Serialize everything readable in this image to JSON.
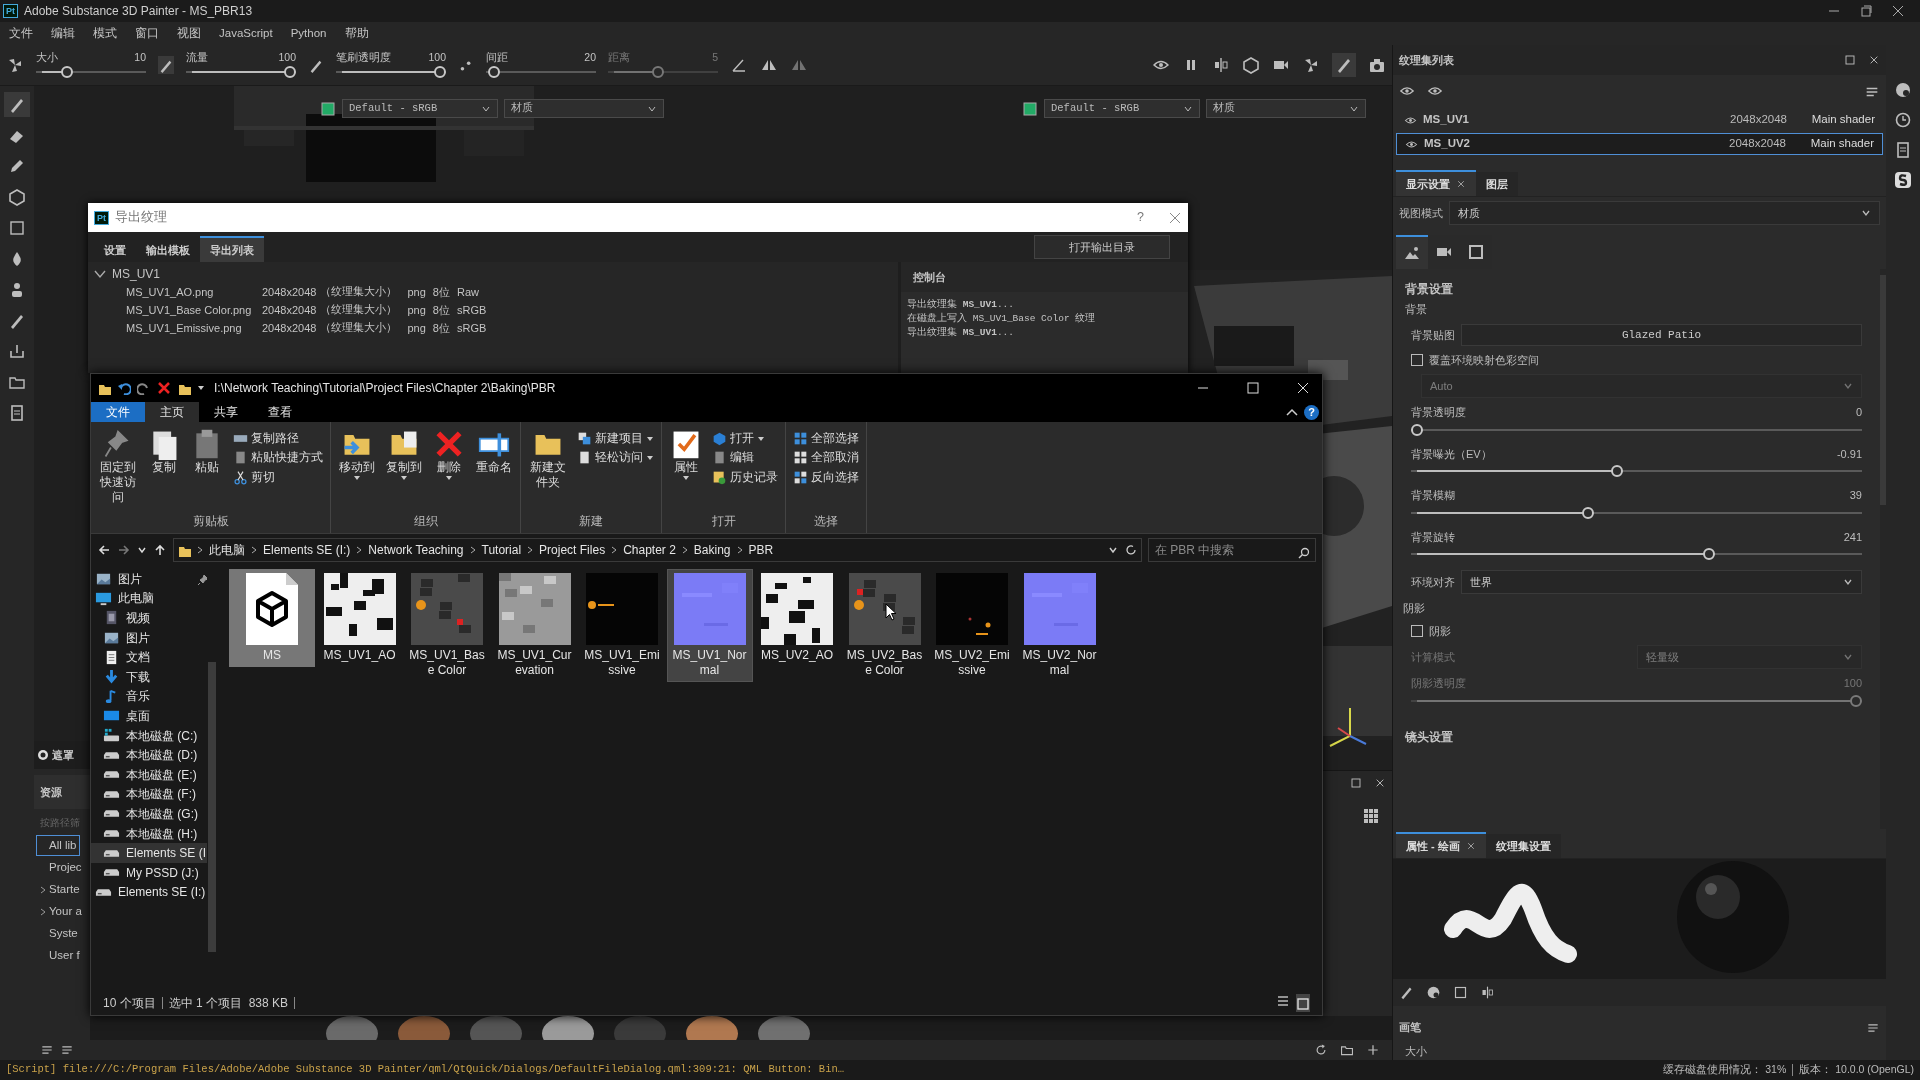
{
  "app": {
    "logo": "Pt",
    "title": "Adobe Substance 3D Painter - MS_PBR13",
    "menu": [
      "文件",
      "编辑",
      "模式",
      "窗口",
      "视图",
      "JavaScript",
      "Python",
      "帮助"
    ]
  },
  "tool_options": {
    "sliders": [
      {
        "label": "大小",
        "value": "10",
        "level": 0.25,
        "disabled": false
      },
      {
        "label": "流量",
        "value": "100",
        "level": 1,
        "disabled": false
      },
      {
        "label": "笔刷透明度",
        "value": "100",
        "level": 1,
        "disabled": false
      },
      {
        "label": "间距",
        "value": "20",
        "level": 0.02,
        "disabled": false
      },
      {
        "label": "距离",
        "value": "5",
        "level": 0.45,
        "disabled": true
      }
    ]
  },
  "viewport_views": [
    {
      "colorspace": "Default - sRGB",
      "mode": "材质"
    },
    {
      "colorspace": "Default - sRGB",
      "mode": "材质"
    }
  ],
  "export_dialog": {
    "logo": "Pt",
    "title": "导出纹理",
    "help": "?",
    "tabs": [
      {
        "label": "设置",
        "selected": false
      },
      {
        "label": "输出模板",
        "selected": false
      },
      {
        "label": "导出列表",
        "selected": true
      }
    ],
    "open_button": "打开输出目录",
    "texture_set": {
      "name": "MS_UV1",
      "expanded": true,
      "files": [
        {
          "name": "MS_UV1_AO.png",
          "size": "2048x2048",
          "note": "（纹理集大小）",
          "format": "png",
          "depth": "8位",
          "colorspace": "Raw"
        },
        {
          "name": "MS_UV1_Base Color.png",
          "size": "2048x2048",
          "note": "（纹理集大小）",
          "format": "png",
          "depth": "8位",
          "colorspace": "sRGB"
        },
        {
          "name": "MS_UV1_Emissive.png",
          "size": "2048x2048",
          "note": "（纹理集大小）",
          "format": "png",
          "depth": "8位",
          "colorspace": "sRGB"
        }
      ]
    },
    "console": {
      "title": "控制台",
      "lines": [
        "导出纹理集 **MS_UV1**...",
        "在磁盘上写入 MS_UV1_Base Color 纹理",
        "导出纹理集 **MS_UV1**..."
      ]
    }
  },
  "explorer": {
    "path": "I:\\Network Teaching\\Tutorial\\Project Files\\Chapter 2\\Baking\\PBR",
    "file_tab": "文件",
    "help": "?",
    "tabs": [
      {
        "label": "主页",
        "selected": true
      },
      {
        "label": "共享",
        "selected": false
      },
      {
        "label": "查看",
        "selected": false
      }
    ],
    "ribbon": [
      {
        "label": "剪贴板",
        "buttons": [
          {
            "label": "固定到快速访问",
            "kind": "pin",
            "dropdown": false
          },
          {
            "label": "复制",
            "kind": "copy",
            "dropdown": false
          },
          {
            "label": "粘贴",
            "kind": "paste",
            "dropdown": false
          }
        ],
        "menu_items": [
          {
            "label": "复制路径",
            "kind": "path",
            "dropdown": false
          },
          {
            "label": "粘贴快捷方式",
            "kind": "shortcut",
            "dropdown": false
          },
          {
            "label": "剪切",
            "kind": "cut",
            "dropdown": false
          }
        ]
      },
      {
        "label": "组织",
        "buttons": [
          {
            "label": "移动到",
            "kind": "move",
            "dropdown": true
          },
          {
            "label": "复制到",
            "kind": "copyto",
            "dropdown": true
          },
          {
            "label": "删除",
            "kind": "delete",
            "dropdown": true
          },
          {
            "label": "重命名",
            "kind": "rename",
            "dropdown": false
          }
        ]
      },
      {
        "label": "新建",
        "buttons": [
          {
            "label": "新建文件夹",
            "kind": "folder",
            "dropdown": false
          }
        ],
        "menu_items": [
          {
            "label": "新建项目",
            "kind": "newitem",
            "dropdown": true
          },
          {
            "label": "轻松访问",
            "kind": "easy",
            "dropdown": true
          }
        ]
      },
      {
        "label": "打开",
        "buttons": [
          {
            "label": "属性",
            "kind": "properties",
            "dropdown": true
          }
        ],
        "menu_items": [
          {
            "label": "打开",
            "kind": "open",
            "dropdown": true
          },
          {
            "label": "编辑",
            "kind": "edit",
            "dropdown": false
          },
          {
            "label": "历史记录",
            "kind": "history",
            "dropdown": false
          }
        ]
      },
      {
        "label": "选择",
        "menu_items": [
          {
            "label": "全部选择",
            "kind": "selectall",
            "dropdown": false
          },
          {
            "label": "全部取消",
            "kind": "selectnone",
            "dropdown": false
          },
          {
            "label": "反向选择",
            "kind": "invert",
            "dropdown": false
          }
        ]
      }
    ],
    "breadcrumb": [
      "此电脑",
      "Elements SE (I:)",
      "Network Teaching",
      "Tutorial",
      "Project Files",
      "Chapter 2",
      "Baking",
      "PBR"
    ],
    "search": {
      "placeholder": "在 PBR 中搜索"
    },
    "nav": [
      {
        "label": "图片",
        "kind": "pictures",
        "pinned": true,
        "selected": false
      },
      {
        "label": "此电脑",
        "kind": "computer",
        "pinned": false,
        "selected": false,
        "children": [
          {
            "label": "视频",
            "kind": "videos",
            "pinned": false,
            "selected": false
          },
          {
            "label": "图片",
            "kind": "pictures",
            "pinned": false,
            "selected": false
          },
          {
            "label": "文档",
            "kind": "documents",
            "pinned": false,
            "selected": false
          },
          {
            "label": "下载",
            "kind": "downloads",
            "pinned": false,
            "selected": false
          },
          {
            "label": "音乐",
            "kind": "music",
            "pinned": false,
            "selected": false
          },
          {
            "label": "桌面",
            "kind": "desktop",
            "pinned": false,
            "selected": false
          },
          {
            "label": "本地磁盘 (C:)",
            "kind": "system-drive",
            "pinned": false,
            "selected": false
          },
          {
            "label": "本地磁盘 (D:)",
            "kind": "drive",
            "pinned": false,
            "selected": false
          },
          {
            "label": "本地磁盘 (E:)",
            "kind": "drive",
            "pinned": false,
            "selected": false
          },
          {
            "label": "本地磁盘 (F:)",
            "kind": "drive",
            "pinned": false,
            "selected": false
          },
          {
            "label": "本地磁盘 (G:)",
            "kind": "drive",
            "pinned": false,
            "selected": false
          },
          {
            "label": "本地磁盘 (H:)",
            "kind": "drive",
            "pinned": false,
            "selected": false
          },
          {
            "label": "Elements SE (I:",
            "kind": "drive",
            "pinned": false,
            "selected": true
          },
          {
            "label": "My PSSD (J:)",
            "kind": "drive",
            "pinned": false,
            "selected": false
          }
        ]
      },
      {
        "label": "Elements SE (I:)",
        "kind": "drive",
        "pinned": false,
        "selected": false
      }
    ],
    "files": [
      {
        "name": "MS",
        "kind": "package",
        "selected": true,
        "hovered": false
      },
      {
        "name": "MS_UV1_AO",
        "kind": "ao-map",
        "selected": false,
        "hovered": false
      },
      {
        "name": "MS_UV1_Base Color",
        "kind": "color-map",
        "selected": false,
        "hovered": false
      },
      {
        "name": "MS_UV1_Curevation",
        "kind": "curvature-map",
        "selected": false,
        "hovered": false
      },
      {
        "name": "MS_UV1_Emissive",
        "kind": "emissive-map",
        "selected": false,
        "hovered": false
      },
      {
        "name": "MS_UV1_Normal",
        "kind": "normal-map",
        "selected": false,
        "hovered": true
      },
      {
        "name": "MS_UV2_AO",
        "kind": "ao-map",
        "selected": false,
        "hovered": false
      },
      {
        "name": "MS_UV2_Base Color",
        "kind": "color-map",
        "selected": false,
        "hovered": false
      },
      {
        "name": "MS_UV2_Emissive",
        "kind": "emissive-map",
        "selected": false,
        "hovered": false
      },
      {
        "name": "MS_UV2_Normal",
        "kind": "normal-map",
        "selected": false,
        "hovered": false
      }
    ],
    "status": {
      "count": "10 个项目",
      "selection": "选中 1 个项目  838 KB"
    }
  },
  "left_dock": {
    "mask": "遮罩",
    "assets": {
      "title": "资源",
      "filter": "按路径筛",
      "items": [
        {
          "label": "All lib",
          "selected": true,
          "expandable": false
        },
        {
          "label": "Projec",
          "selected": false,
          "expandable": false
        },
        {
          "label": "Starte",
          "selected": false,
          "expandable": true
        },
        {
          "label": "Your a",
          "selected": false,
          "expandable": true
        },
        {
          "label": "Syste",
          "selected": false,
          "expandable": false
        },
        {
          "label": "User f",
          "selected": false,
          "expandable": false
        }
      ]
    }
  },
  "right_panel": {
    "texture_sets": {
      "title": "纹理集列表",
      "rows": [
        {
          "name": "MS_UV1",
          "size": "2048x2048",
          "shader": "Main shader",
          "selected": false
        },
        {
          "name": "MS_UV2",
          "size": "2048x2048",
          "shader": "Main shader",
          "selected": true
        }
      ]
    },
    "display_tabs": [
      {
        "label": "显示设置",
        "selected": true,
        "closable": true
      },
      {
        "label": "图层",
        "selected": false,
        "closable": false
      }
    ],
    "view_mode": {
      "label": "视图模式",
      "value": "材质"
    },
    "icon_tabs": [
      {
        "kind": "landscape",
        "selected": true
      },
      {
        "kind": "camera",
        "selected": false
      },
      {
        "kind": "frame",
        "selected": false
      }
    ],
    "settings": {
      "title": "背景设置",
      "group": "背景",
      "rows": [
        {
          "kind": "field",
          "label": "背景贴图",
          "value": "Glazed Patio",
          "disabled": false
        },
        {
          "kind": "checkbox",
          "label": "覆盖环境映射色彩空间",
          "checked": false,
          "disabled": false
        },
        {
          "kind": "select",
          "value": "Auto",
          "disabled": true
        },
        {
          "kind": "slider",
          "label": "背景透明度",
          "value": "0",
          "level": 0,
          "disabled": false
        },
        {
          "kind": "slider",
          "label": "背景曝光（EV）",
          "value": "-0.91",
          "level": 0.456,
          "disabled": false
        },
        {
          "kind": "slider",
          "label": "背景模糊",
          "value": "39",
          "level": 0.39,
          "disabled": false
        },
        {
          "kind": "slider",
          "label": "背景旋转",
          "value": "241",
          "level": 0.665,
          "disabled": false
        },
        {
          "kind": "select",
          "label": "环境对齐",
          "value": "世界",
          "disabled": false
        },
        {
          "kind": "section",
          "label": "阴影",
          "disabled": false
        },
        {
          "kind": "checkbox",
          "label": "阴影",
          "checked": false,
          "disabled": false
        },
        {
          "kind": "select",
          "label": "计算模式",
          "value": "轻量级",
          "disabled": true
        },
        {
          "kind": "slider",
          "label": "阴影透明度",
          "value": "100",
          "level": 1,
          "disabled": true
        }
      ]
    },
    "camera_title": "镜头设置",
    "props_tabs": [
      {
        "label": "属性 - 绘画",
        "selected": true,
        "closable": true
      },
      {
        "label": "纹理集设置",
        "selected": false,
        "closable": false
      }
    ],
    "brush": {
      "section": "画笔",
      "size_label": "大小"
    }
  },
  "status_bar": {
    "message": "[Script] file:///C:/Program Files/Adobe/Adobe Substance 3D Painter/qml/QtQuick/Dialogs/DefaultFileDialog.qml:309:21: QML Button: Bin…",
    "cache": "缓存磁盘使用情况： 31%",
    "version": "版本： 10.0.0 (OpenGL)"
  }
}
